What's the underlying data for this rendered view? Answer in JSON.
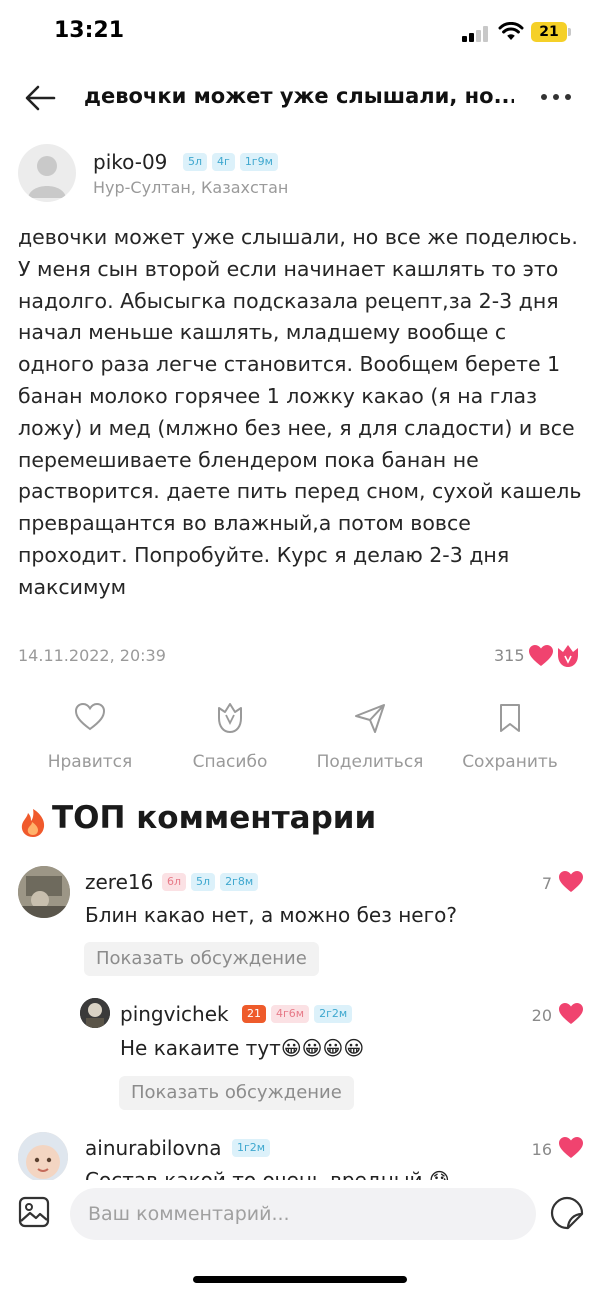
{
  "status_bar": {
    "time": "13:21",
    "battery": "21"
  },
  "nav": {
    "title": "девочки может уже слышали, но..."
  },
  "post": {
    "author_name": "piko-09",
    "author_location": "Нур-Султан, Казахстан",
    "badges": [
      "5л",
      "4г",
      "1г9м"
    ],
    "text": "девочки может уже слышали, но все же поделюсь. У меня сын второй если начинает кашлять то это надолго. Абысыгка подсказала рецепт,за 2-3 дня начал меньше кашлять, младшему вообще с одного раза легче становится. Вообщем берете 1 банан молоко горячее 1 ложку какао (я на глаз ложу) и мед (млжно без нее, я для сладости) и все перемешиваете блендером пока банан не растворится. даете пить перед сном, сухой кашель превращантся во влажный,а потом вовсе проходит. Попробуйте. Курс я делаю 2-3 дня максимум",
    "date": "14.11.2022, 20:39",
    "likes": "315"
  },
  "actions": {
    "like": "Нравится",
    "thanks": "Спасибо",
    "share": "Поделиться",
    "save": "Сохранить"
  },
  "top_comments": {
    "heading": "ТОП комментарии",
    "show_discussion": "Показать обсуждение",
    "items": [
      {
        "name": "zere16",
        "badges": [
          "6л",
          "5л",
          "2г8м"
        ],
        "text": "Блин какао нет, а можно без него?",
        "likes": "7"
      },
      {
        "name": "pingvichek",
        "badges": [
          "21",
          "4г6м",
          "2г2м"
        ],
        "text": "Не какаите тут😀😀😀😀",
        "likes": "20"
      },
      {
        "name": "ainurabilovna",
        "badges": [
          "1г2м"
        ],
        "text": "Состав какой то очень вредный 😰",
        "likes": "16"
      }
    ]
  },
  "composer": {
    "placeholder": "Ваш комментарий..."
  },
  "colors": {
    "accent_pink": "#f0436f",
    "badge_blue": "#dcf1fa",
    "badge_pink": "#fbe1e4",
    "badge_orange": "#ee5b2b"
  }
}
